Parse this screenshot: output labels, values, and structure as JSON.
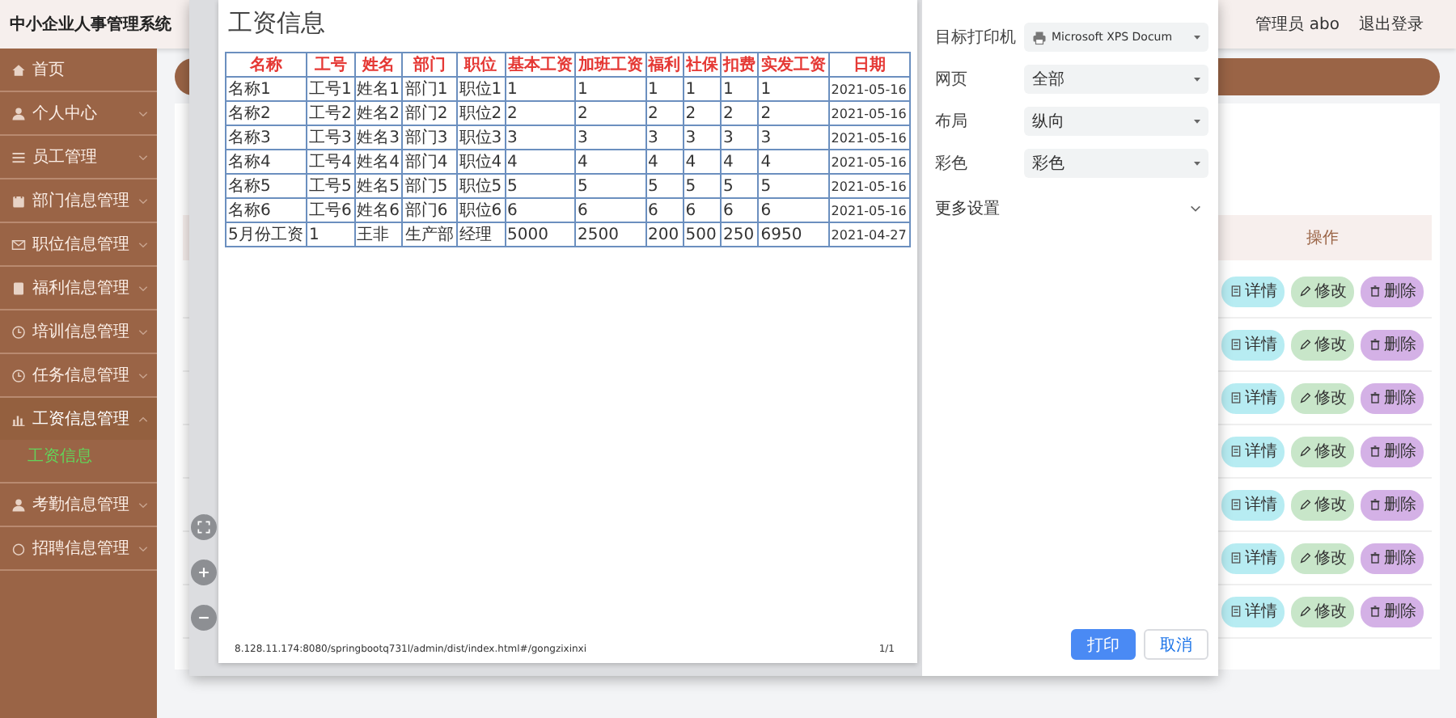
{
  "header": {
    "title": "中小企业人事管理系统",
    "user": "管理员 abo",
    "logout": "退出登录"
  },
  "sidebar": {
    "items": [
      {
        "label": "首页",
        "kind": "link"
      },
      {
        "label": "个人中心",
        "kind": "menu",
        "expanded": false
      },
      {
        "label": "员工管理",
        "kind": "menu",
        "expanded": false
      },
      {
        "label": "部门信息管理",
        "kind": "menu",
        "expanded": false
      },
      {
        "label": "职位信息管理",
        "kind": "menu",
        "expanded": false
      },
      {
        "label": "福利信息管理",
        "kind": "menu",
        "expanded": false
      },
      {
        "label": "培训信息管理",
        "kind": "menu",
        "expanded": false
      },
      {
        "label": "任务信息管理",
        "kind": "menu",
        "expanded": false
      },
      {
        "label": "工资信息管理",
        "kind": "menu",
        "expanded": true,
        "children": [
          {
            "label": "工资信息",
            "selected": true
          }
        ]
      },
      {
        "label": "考勤信息管理",
        "kind": "menu",
        "expanded": false
      },
      {
        "label": "招聘信息管理",
        "kind": "menu",
        "expanded": false
      }
    ]
  },
  "table": {
    "columns": [
      "操作"
    ],
    "rows": [
      {
        "actions": [
          "详情",
          "修改",
          "删除"
        ]
      },
      {
        "actions": [
          "详情",
          "修改",
          "删除"
        ]
      },
      {
        "actions": [
          "详情",
          "修改",
          "删除"
        ]
      },
      {
        "actions": [
          "详情",
          "修改",
          "删除"
        ]
      },
      {
        "actions": [
          "详情",
          "修改",
          "删除"
        ]
      },
      {
        "actions": [
          "详情",
          "修改",
          "删除"
        ]
      },
      {
        "actions": [
          "详情",
          "修改",
          "删除"
        ]
      }
    ]
  },
  "print_dialog": {
    "preview": {
      "title": "工资信息",
      "columns": [
        "名称",
        "工号",
        "姓名",
        "部门",
        "职位",
        "基本工资",
        "加班工资",
        "福利",
        "社保",
        "扣费",
        "实发工资",
        "日期"
      ],
      "rows": [
        [
          "名称1",
          "工号1",
          "姓名1",
          "部门1",
          "职位1",
          "1",
          "1",
          "1",
          "1",
          "1",
          "1",
          "2021-05-16"
        ],
        [
          "名称2",
          "工号2",
          "姓名2",
          "部门2",
          "职位2",
          "2",
          "2",
          "2",
          "2",
          "2",
          "2",
          "2021-05-16"
        ],
        [
          "名称3",
          "工号3",
          "姓名3",
          "部门3",
          "职位3",
          "3",
          "3",
          "3",
          "3",
          "3",
          "3",
          "2021-05-16"
        ],
        [
          "名称4",
          "工号4",
          "姓名4",
          "部门4",
          "职位4",
          "4",
          "4",
          "4",
          "4",
          "4",
          "4",
          "2021-05-16"
        ],
        [
          "名称5",
          "工号5",
          "姓名5",
          "部门5",
          "职位5",
          "5",
          "5",
          "5",
          "5",
          "5",
          "5",
          "2021-05-16"
        ],
        [
          "名称6",
          "工号6",
          "姓名6",
          "部门6",
          "职位6",
          "6",
          "6",
          "6",
          "6",
          "6",
          "6",
          "2021-05-16"
        ],
        [
          "5月份工资",
          "1",
          "王非",
          "生产部",
          "经理",
          "5000",
          "2500",
          "200",
          "500",
          "250",
          "6950",
          "2021-04-27"
        ]
      ],
      "url": "8.128.11.174:8080/springbootq731l/admin/dist/index.html#/gongzixinxi",
      "page_number": "1/1"
    },
    "settings": [
      {
        "label": "目标打印机",
        "value": "Microsoft XPS Docum",
        "kind": "printer"
      },
      {
        "label": "网页",
        "value": "全部",
        "kind": "select"
      },
      {
        "label": "布局",
        "value": "纵向",
        "kind": "select"
      },
      {
        "label": "彩色",
        "value": "彩色",
        "kind": "select"
      }
    ],
    "more_settings": "更多设置",
    "buttons": [
      {
        "label": "打印",
        "kind": "primary"
      },
      {
        "label": "取消",
        "kind": "default"
      }
    ]
  }
}
